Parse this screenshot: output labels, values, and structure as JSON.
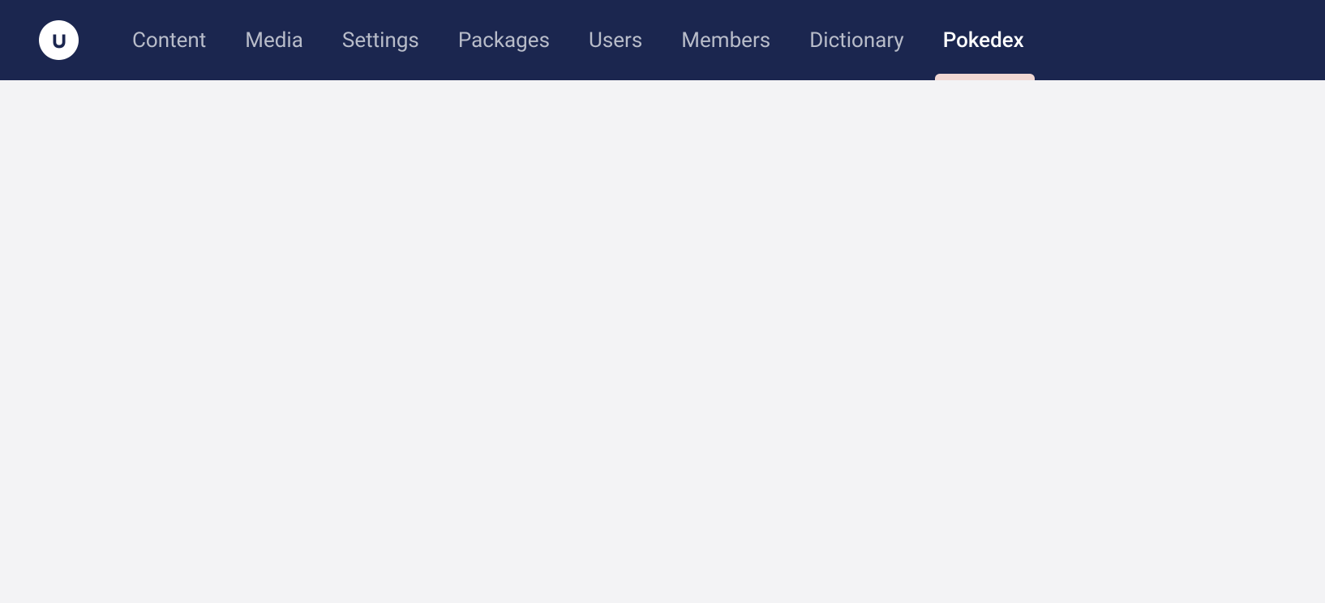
{
  "nav": {
    "items": [
      {
        "label": "Content",
        "active": false
      },
      {
        "label": "Media",
        "active": false
      },
      {
        "label": "Settings",
        "active": false
      },
      {
        "label": "Packages",
        "active": false
      },
      {
        "label": "Users",
        "active": false
      },
      {
        "label": "Members",
        "active": false
      },
      {
        "label": "Dictionary",
        "active": false
      },
      {
        "label": "Pokedex",
        "active": true
      }
    ]
  }
}
